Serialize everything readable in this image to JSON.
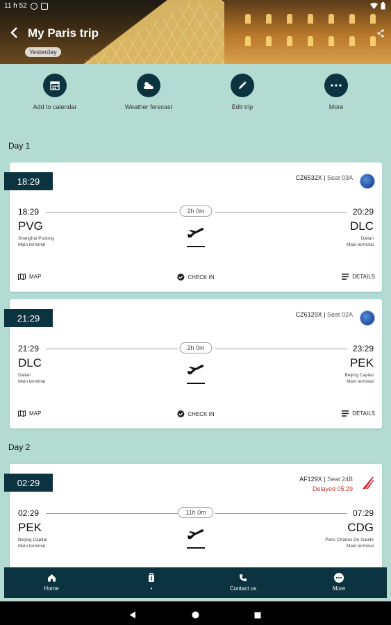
{
  "status": {
    "time": "11 h 52"
  },
  "header": {
    "title": "My Paris trip",
    "badge": "Yesterday"
  },
  "actions": [
    {
      "label": "Add to calendar",
      "icon": "calendar-icon"
    },
    {
      "label": "Weather forecast",
      "icon": "weather-icon"
    },
    {
      "label": "Edit trip",
      "icon": "pencil-icon"
    },
    {
      "label": "More",
      "icon": "more-icon"
    }
  ],
  "days": [
    {
      "label": "Day 1"
    },
    {
      "label": "Day 2"
    }
  ],
  "flights": [
    {
      "tag_time": "18:29",
      "flight": "CZ6532X",
      "seat": "Seat 03A",
      "delayed": "",
      "dep_time": "18:29",
      "dep_code": "PVG",
      "dep_city": "Shanghai Pudong",
      "dep_terminal": "Main terminal",
      "duration": "2h 0m",
      "arr_time": "20:29",
      "arr_code": "DLC",
      "arr_city": "Dalian",
      "arr_terminal": "Main terminal",
      "airline": "cz"
    },
    {
      "tag_time": "21:29",
      "flight": "CZ6129X",
      "seat": "Seat 02A",
      "delayed": "",
      "dep_time": "21:29",
      "dep_code": "DLC",
      "dep_city": "Dalian",
      "dep_terminal": "Main terminal",
      "duration": "2h 0m",
      "arr_time": "23:29",
      "arr_code": "PEK",
      "arr_city": "Beijing Capital",
      "arr_terminal": "Main terminal",
      "airline": "cz"
    },
    {
      "tag_time": "02:29",
      "flight": "AF129X",
      "seat": "Seat 24B",
      "delayed": "Delayed 05:29",
      "dep_time": "02:29",
      "dep_code": "PEK",
      "dep_city": "Beijing Capital",
      "dep_terminal": "Main terminal",
      "duration": "11h 0m",
      "arr_time": "07:29",
      "arr_code": "CDG",
      "arr_city": "Paris Charles De Gaulle",
      "arr_terminal": "Main terminal",
      "airline": "af"
    }
  ],
  "card_footer": {
    "map": "MAP",
    "checkin": "CHECK IN",
    "details": "DETAILS"
  },
  "nav": [
    {
      "label": "Home",
      "icon": "home-icon"
    },
    {
      "label": "•",
      "icon": "luggage-icon"
    },
    {
      "label": "Contact us",
      "icon": "phone-icon"
    },
    {
      "label": "More",
      "icon": "more-icon"
    }
  ],
  "colors": {
    "accent": "#0c3340",
    "background": "#b3dbd2",
    "delayed": "#c0392b"
  }
}
